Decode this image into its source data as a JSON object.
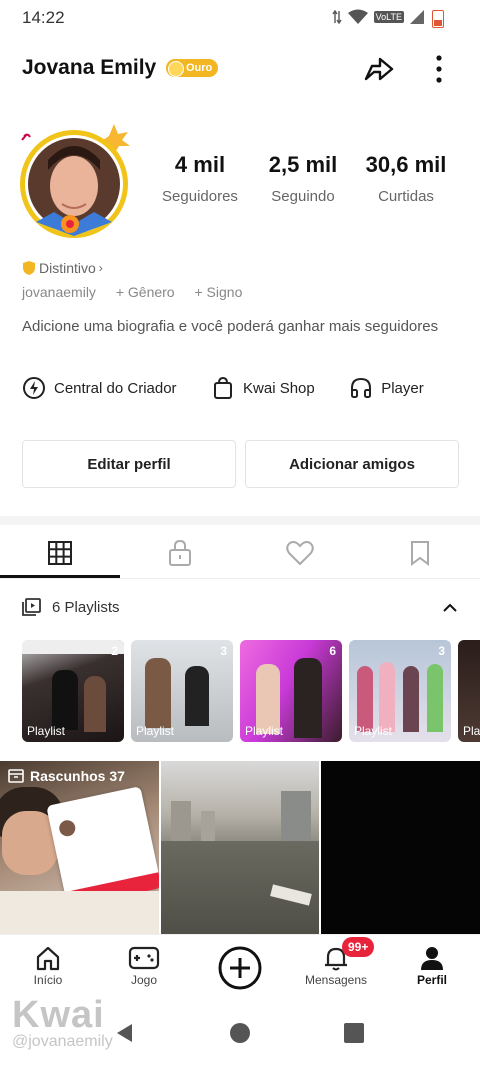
{
  "status_bar": {
    "time": "14:22",
    "network": "VoLTE"
  },
  "profile": {
    "name": "Jovana Emily",
    "level_badge": "Ouro",
    "stats": [
      {
        "value": "4 mil",
        "label": "Seguidores"
      },
      {
        "value": "2,5 mil",
        "label": "Seguindo"
      },
      {
        "value": "30,6 mil",
        "label": "Curtidas"
      }
    ],
    "distintivo": "Distintivo",
    "username": "jovanaemily",
    "add_gender": "+ Gênero",
    "add_sign": "+ Signo",
    "bio": "Adicione uma biografia e você poderá ganhar mais seguidores"
  },
  "tools": [
    {
      "label": "Central do Criador",
      "icon": "creator-center-icon"
    },
    {
      "label": "Kwai Shop",
      "icon": "shopping-bag-icon"
    },
    {
      "label": "Player",
      "icon": "headphones-icon"
    }
  ],
  "buttons": {
    "edit": "Editar perfil",
    "add_friends": "Adicionar amigos"
  },
  "tabs": [
    "grid-icon",
    "lock-icon",
    "heart-icon",
    "bookmark-icon"
  ],
  "playlists": {
    "header": "6 Playlists",
    "items": [
      {
        "label": "Playlist",
        "count": "2"
      },
      {
        "label": "Playlist",
        "count": "3"
      },
      {
        "label": "Playlist",
        "count": "6"
      },
      {
        "label": "Playlist",
        "count": "3"
      },
      {
        "label": "Pla",
        "count": ""
      }
    ]
  },
  "drafts": {
    "label": "Rascunhos 37"
  },
  "bottom_nav": [
    {
      "label": "Início",
      "icon": "home-icon"
    },
    {
      "label": "Jogo",
      "icon": "gamepad-icon"
    },
    {
      "label": "",
      "icon": "plus-circle-icon"
    },
    {
      "label": "Mensagens",
      "icon": "bell-icon",
      "badge": "99+"
    },
    {
      "label": "Perfil",
      "icon": "person-icon"
    }
  ],
  "watermark": {
    "brand": "Kwai",
    "user": "@jovanaemily"
  },
  "colors": {
    "gold": "#f3b623",
    "badge_red": "#e8243d"
  }
}
